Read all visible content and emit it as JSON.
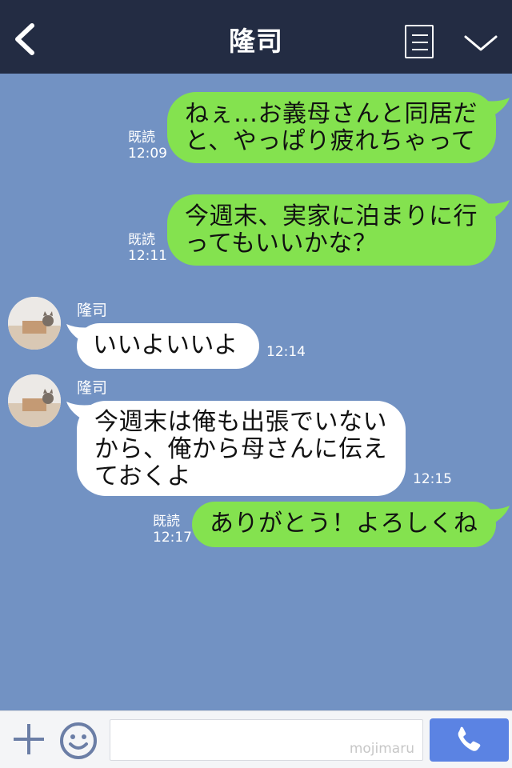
{
  "header": {
    "title": "隆司"
  },
  "messages": [
    {
      "from": "me",
      "lines": [
        "ねぇ…お義母さんと同居だ",
        "と、やっぱり疲れちゃって"
      ],
      "read": "既読",
      "time": "12:09"
    },
    {
      "from": "me",
      "lines": [
        "今週末、実家に泊まりに行",
        "ってもいいかな？"
      ],
      "read": "既読",
      "time": "12:11"
    },
    {
      "from": "other",
      "sender": "隆司",
      "lines": [
        "いいよいいよ"
      ],
      "time": "12:14"
    },
    {
      "from": "other",
      "sender": "隆司",
      "lines": [
        "今週末は俺も出張でいない",
        "から、俺から母さんに伝え",
        "ておくよ"
      ],
      "time": "12:15"
    },
    {
      "from": "me",
      "lines": [
        "ありがとう！よろしくね"
      ],
      "read": "既読",
      "time": "12:17"
    }
  ],
  "footer": {
    "watermark": "mojimaru",
    "input_value": ""
  },
  "colors": {
    "header_bg": "#232c43",
    "chat_bg": "#7292c3",
    "my_bubble": "#84e24f",
    "their_bubble": "#ffffff",
    "call_button": "#5b83e3"
  },
  "icons": {
    "back": "chevron-left-icon",
    "menu": "menu-icon",
    "collapse": "chevron-down-icon",
    "plus": "plus-icon",
    "emoji": "smiley-icon",
    "call": "phone-icon"
  }
}
